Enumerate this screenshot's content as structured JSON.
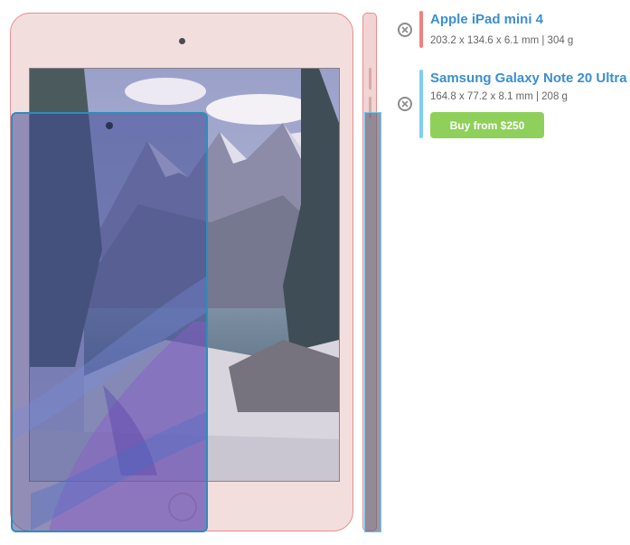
{
  "devices": [
    {
      "name": "Apple iPad mini 4",
      "specs": "203.2 x 134.6 x 6.1 mm | 304 g",
      "color": "#f08080"
    },
    {
      "name": "Samsung Galaxy Note 20 Ultra",
      "specs": "164.8 x 77.2 x 8.1 mm | 208 g",
      "color": "#7fcff5",
      "buy_label": "Buy from $250"
    }
  ],
  "icons": {
    "remove": "close-circle-icon"
  }
}
